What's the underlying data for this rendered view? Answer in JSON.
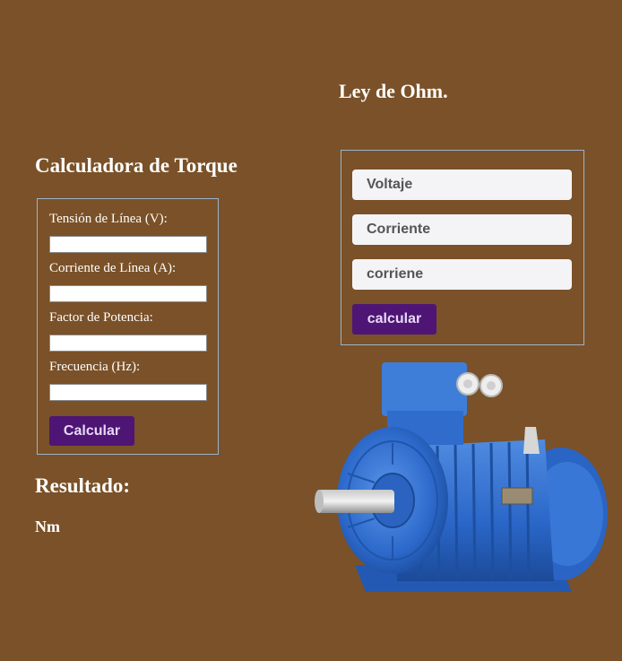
{
  "torque": {
    "title": "Calculadora de Torque",
    "fields": [
      {
        "label": "Tensión de Línea (V):",
        "value": ""
      },
      {
        "label": "Corriente de Línea (A):",
        "value": ""
      },
      {
        "label": "Factor de Potencia:",
        "value": ""
      },
      {
        "label": "Frecuencia (Hz):",
        "value": ""
      }
    ],
    "button_label": "Calcular"
  },
  "result": {
    "title": "Resultado:",
    "value": "Nm"
  },
  "ohm": {
    "title": "Ley de Ohm.",
    "inputs": [
      {
        "placeholder": "Voltaje"
      },
      {
        "placeholder": "Corriente"
      },
      {
        "placeholder": "corriene"
      }
    ],
    "button_label": "calcular"
  },
  "colors": {
    "background": "#7a5128",
    "button": "#4e1575",
    "motor_blue": "#2f6fd0"
  },
  "images": {
    "motor": "electric-motor-image"
  }
}
